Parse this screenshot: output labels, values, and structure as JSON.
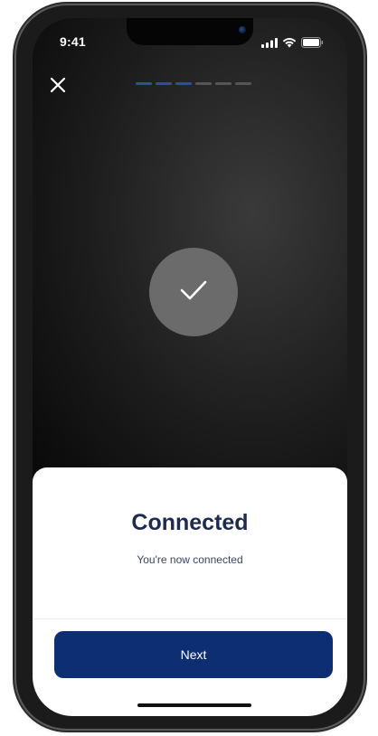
{
  "status_bar": {
    "time": "9:41",
    "icons": [
      "signal-icon",
      "wifi-icon",
      "battery-icon"
    ]
  },
  "header": {
    "close_icon": "close-icon",
    "progress": {
      "total_steps": 6,
      "completed_steps": 3
    }
  },
  "status": {
    "icon": "checkmark-icon"
  },
  "sheet": {
    "title": "Connected",
    "subtitle": "You're now connected",
    "next_label": "Next"
  },
  "colors": {
    "accent": "#0d2e72",
    "progress_active": "#2a4f9e",
    "progress_inactive": "#555555",
    "title": "#1d2b4f",
    "check_circle": "#6b6b6b"
  }
}
